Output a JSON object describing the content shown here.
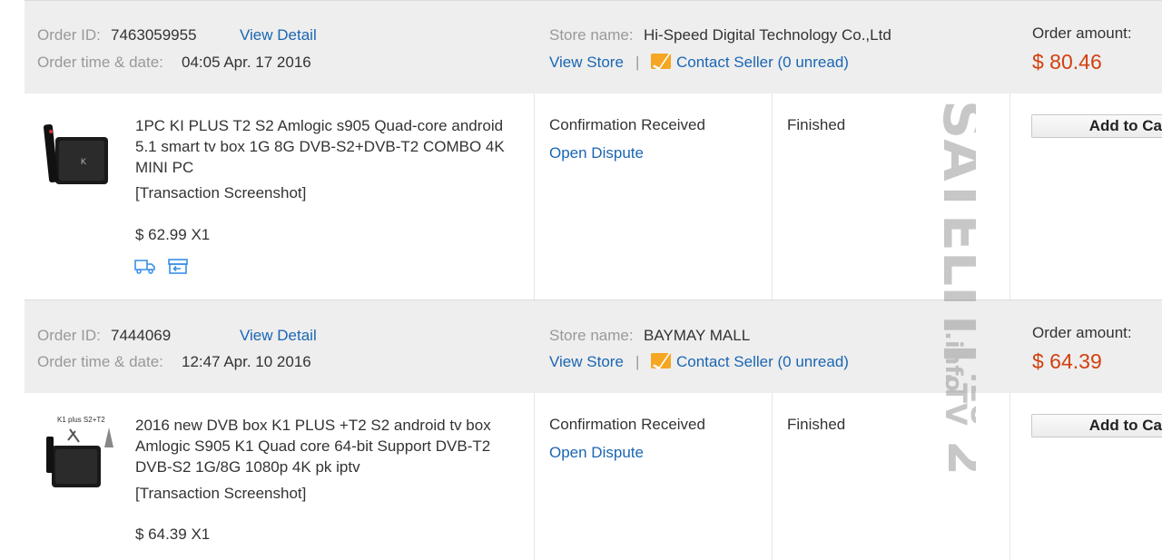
{
  "orders": [
    {
      "order_id_label": "Order ID:",
      "order_id": "7463059955",
      "view_detail": "View Detail",
      "time_label": "Order time & date:",
      "time_value": "04:05 Apr. 17 2016",
      "store_label": "Store name:",
      "store_name": "Hi-Speed Digital Technology Co.,Ltd",
      "view_store": "View Store",
      "separator": "|",
      "contact_seller": "Contact Seller",
      "unread": "(0 unread)",
      "amount_label": "Order amount:",
      "amount": "$ 80.46",
      "product_title": "1PC KI PLUS T2 S2 Amlogic s905 Quad-core android 5.1 smart tv box 1G 8G DVB-S2+DVB-T2 COMBO 4K MINI PC",
      "screenshot_link": "[Transaction Screenshot]",
      "unit_price": "$ 62.99 X1",
      "status": "Confirmation Received",
      "dispute": "Open Dispute",
      "state": "Finished",
      "cart_button": "Add to Cart"
    },
    {
      "order_id_label": "Order ID:",
      "order_id": "7444069",
      "view_detail": "View Detail",
      "time_label": "Order time & date:",
      "time_value": "12:47 Apr. 10 2016",
      "store_label": "Store name:",
      "store_name": "BAYMAY MALL",
      "view_store": "View Store",
      "separator": "|",
      "contact_seller": "Contact Seller",
      "unread": "(0 unread)",
      "amount_label": "Order amount:",
      "amount": "$ 64.39",
      "product_title": "2016 new DVB box K1 PLUS +T2 S2 android tv box Amlogic S905 K1 Quad core 64-bit Support DVB-T2 DVB-S2 1G/8G 1080p 4K pk iptv",
      "screenshot_link": "[Transaction Screenshot]",
      "unit_price": "$ 64.39 X1",
      "status": "Confirmation Received",
      "dispute": "Open Dispute",
      "state": "Finished",
      "cart_button": "Add to Cart",
      "thumb_caption": "K1 plus S2+T2"
    }
  ],
  "watermark": {
    "line1": "SATELITI",
    "line2": ".info",
    "line3": ".EU",
    "line4": ".TV",
    "line5": "2"
  },
  "colors": {
    "link": "#1a66b3",
    "price": "#d23f0f",
    "header_bg": "#eeeeee",
    "mail_icon": "#f5a623"
  },
  "icons": [
    "truck-icon",
    "package-return-icon",
    "mail-icon"
  ]
}
